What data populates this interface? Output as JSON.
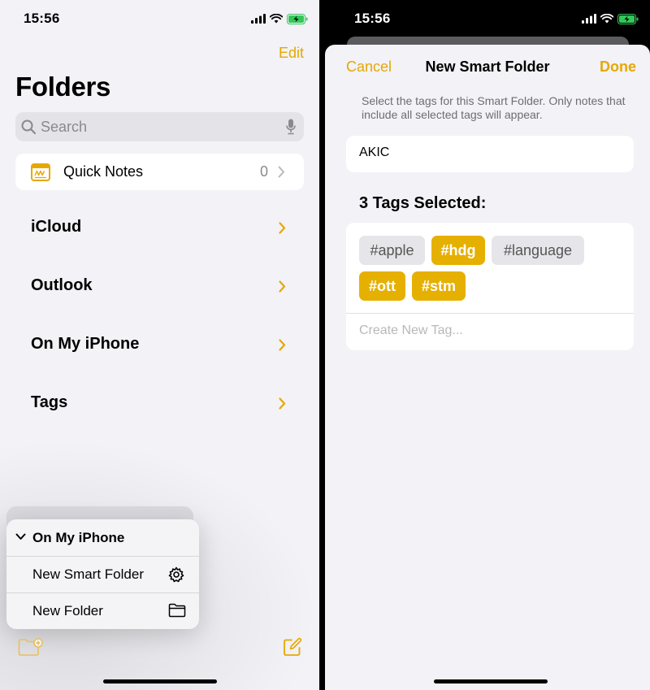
{
  "left": {
    "status": {
      "time": "15:56"
    },
    "edit_label": "Edit",
    "title": "Folders",
    "search": {
      "placeholder": "Search"
    },
    "quick_notes": {
      "label": "Quick Notes",
      "count": "0"
    },
    "accounts": [
      {
        "label": "iCloud"
      },
      {
        "label": "Outlook"
      },
      {
        "label": "On My iPhone"
      },
      {
        "label": "Tags"
      }
    ],
    "context_menu": {
      "header": "On My iPhone",
      "items": [
        {
          "label": "New Smart Folder",
          "icon": "gear-icon"
        },
        {
          "label": "New Folder",
          "icon": "folder-icon"
        }
      ]
    }
  },
  "right": {
    "status": {
      "time": "15:56"
    },
    "sheet": {
      "cancel_label": "Cancel",
      "title": "New Smart Folder",
      "done_label": "Done",
      "description": "Select the tags for this Smart Folder. Only notes that include all selected tags will appear.",
      "name_value": "AKIC",
      "tags_heading": "3 Tags Selected:",
      "tags": [
        {
          "label": "#apple",
          "selected": false
        },
        {
          "label": "#hdg",
          "selected": true
        },
        {
          "label": "#language",
          "selected": false
        },
        {
          "label": "#ott",
          "selected": true
        },
        {
          "label": "#stm",
          "selected": true
        }
      ],
      "create_tag_placeholder": "Create New Tag..."
    }
  },
  "colors": {
    "accent": "#e6a800",
    "tag_selected": "#e6b000",
    "tag_unselected": "#e6e6ea",
    "background": "#f2f2f7"
  }
}
